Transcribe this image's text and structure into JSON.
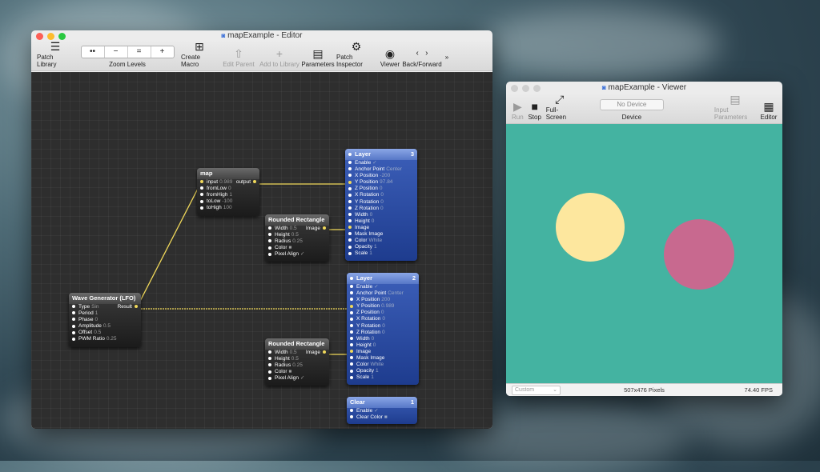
{
  "editor": {
    "title": "mapExample - Editor",
    "toolbar": {
      "patch_library": "Patch Library",
      "zoom_buttons": [
        "••",
        "−",
        "=",
        "+"
      ],
      "zoom_label": "Zoom Levels",
      "create_macro": "Create Macro",
      "edit_parent": "Edit Parent",
      "add_to_library": "Add to Library",
      "parameters": "Parameters",
      "patch_inspector": "Patch Inspector",
      "viewer": "Viewer",
      "back_forward": "Back/Forward",
      "overflow": "»"
    },
    "nodes": {
      "map": {
        "title": "map",
        "inputs": [
          {
            "label": "input",
            "value": "0.989"
          },
          {
            "label": "fromLow",
            "value": "0"
          },
          {
            "label": "fromHigh",
            "value": "1"
          },
          {
            "label": "toLow",
            "value": "-100"
          },
          {
            "label": "toHigh",
            "value": "100"
          }
        ],
        "output": "output"
      },
      "rect1": {
        "title": "Rounded Rectangle",
        "inputs": [
          {
            "label": "Width",
            "value": "0.5"
          },
          {
            "label": "Height",
            "value": "0.5"
          },
          {
            "label": "Radius",
            "value": "0.25"
          },
          {
            "label": "Color",
            "value": "■"
          },
          {
            "label": "Pixel Align",
            "value": "✓"
          }
        ],
        "output": "Image"
      },
      "rect2": {
        "title": "Rounded Rectangle",
        "inputs": [
          {
            "label": "Width",
            "value": "0.5"
          },
          {
            "label": "Height",
            "value": "0.5"
          },
          {
            "label": "Radius",
            "value": "0.25"
          },
          {
            "label": "Color",
            "value": "■"
          },
          {
            "label": "Pixel Align",
            "value": "✓"
          }
        ],
        "output": "Image"
      },
      "wave": {
        "title": "Wave Generator (LFO)",
        "inputs": [
          {
            "label": "Type",
            "value": "Sin"
          },
          {
            "label": "Period",
            "value": "1"
          },
          {
            "label": "Phase",
            "value": "0"
          },
          {
            "label": "Amplitude",
            "value": "0.5"
          },
          {
            "label": "Offset",
            "value": "0.5"
          },
          {
            "label": "PWM Ratio",
            "value": "0.25"
          }
        ],
        "output": "Result"
      },
      "layer3": {
        "title": "Layer",
        "badge": "3",
        "inputs": [
          {
            "label": "Enable",
            "value": "✓"
          },
          {
            "label": "Anchor Point",
            "value": "Center"
          },
          {
            "label": "X Position",
            "value": "-200"
          },
          {
            "label": "Y Position",
            "value": "97.84"
          },
          {
            "label": "Z Position",
            "value": "0"
          },
          {
            "label": "X Rotation",
            "value": "0"
          },
          {
            "label": "Y Rotation",
            "value": "0"
          },
          {
            "label": "Z Rotation",
            "value": "0"
          },
          {
            "label": "Width",
            "value": "0"
          },
          {
            "label": "Height",
            "value": "0"
          },
          {
            "label": "Image",
            "value": ""
          },
          {
            "label": "Mask Image",
            "value": ""
          },
          {
            "label": "Color",
            "value": "White"
          },
          {
            "label": "Opacity",
            "value": "1"
          },
          {
            "label": "Scale",
            "value": "1"
          }
        ]
      },
      "layer2": {
        "title": "Layer",
        "badge": "2",
        "inputs": [
          {
            "label": "Enable",
            "value": "✓"
          },
          {
            "label": "Anchor Point",
            "value": "Center"
          },
          {
            "label": "X Position",
            "value": "200"
          },
          {
            "label": "Y Position",
            "value": "0.989"
          },
          {
            "label": "Z Position",
            "value": "0"
          },
          {
            "label": "X Rotation",
            "value": "0"
          },
          {
            "label": "Y Rotation",
            "value": "0"
          },
          {
            "label": "Z Rotation",
            "value": "0"
          },
          {
            "label": "Width",
            "value": "0"
          },
          {
            "label": "Height",
            "value": "0"
          },
          {
            "label": "Image",
            "value": ""
          },
          {
            "label": "Mask Image",
            "value": ""
          },
          {
            "label": "Color",
            "value": "White"
          },
          {
            "label": "Opacity",
            "value": "1"
          },
          {
            "label": "Scale",
            "value": "1"
          }
        ]
      },
      "clear": {
        "title": "Clear",
        "badge": "1",
        "inputs": [
          {
            "label": "Enable",
            "value": "✓"
          },
          {
            "label": "Clear Color",
            "value": "■"
          }
        ]
      }
    }
  },
  "viewer": {
    "title": "mapExample - Viewer",
    "toolbar": {
      "run": "Run",
      "stop": "Stop",
      "fullscreen": "Full-Screen",
      "device_select": "No Device",
      "device_label": "Device",
      "input_parameters": "Input Parameters",
      "editor": "Editor"
    },
    "status": {
      "size_select": "Custom",
      "pixels": "507x476 Pixels",
      "fps": "74.40 FPS"
    },
    "colors": {
      "background": "#44b3a1",
      "circle_left": "#fde79e",
      "circle_right": "#c8698f"
    }
  }
}
